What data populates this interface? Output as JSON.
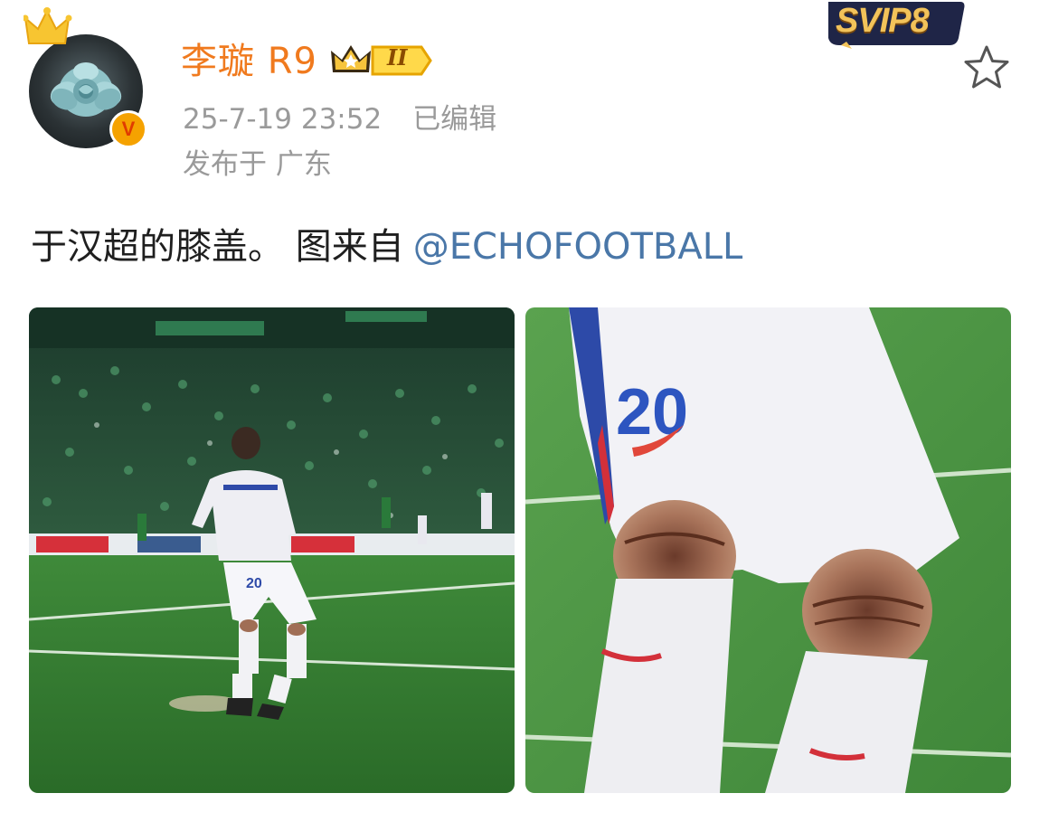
{
  "post": {
    "author": {
      "name": "李璇 R9",
      "avatar_icon": "rose-avatar",
      "crown_icon": "crown-icon",
      "verified_icon": "verified-v-icon",
      "verified_mark": "V",
      "rank_badge": "II",
      "svip_badge": "SVIP8"
    },
    "timestamp": "25-7-19 23:52",
    "edited_label": "已编辑",
    "location": "发布于 广东",
    "text": "于汉超的膝盖。 图来自",
    "mention": "@ECHOFOOTBALL",
    "images": [
      {
        "alt": "football-player-on-pitch",
        "jersey_number": "20"
      },
      {
        "alt": "player-knees-closeup",
        "jersey_number": "20"
      }
    ]
  },
  "colors": {
    "username": "#f07a1e",
    "meta": "#9a9a9a",
    "mention": "#4a77a8",
    "text": "#1f1f1f"
  }
}
